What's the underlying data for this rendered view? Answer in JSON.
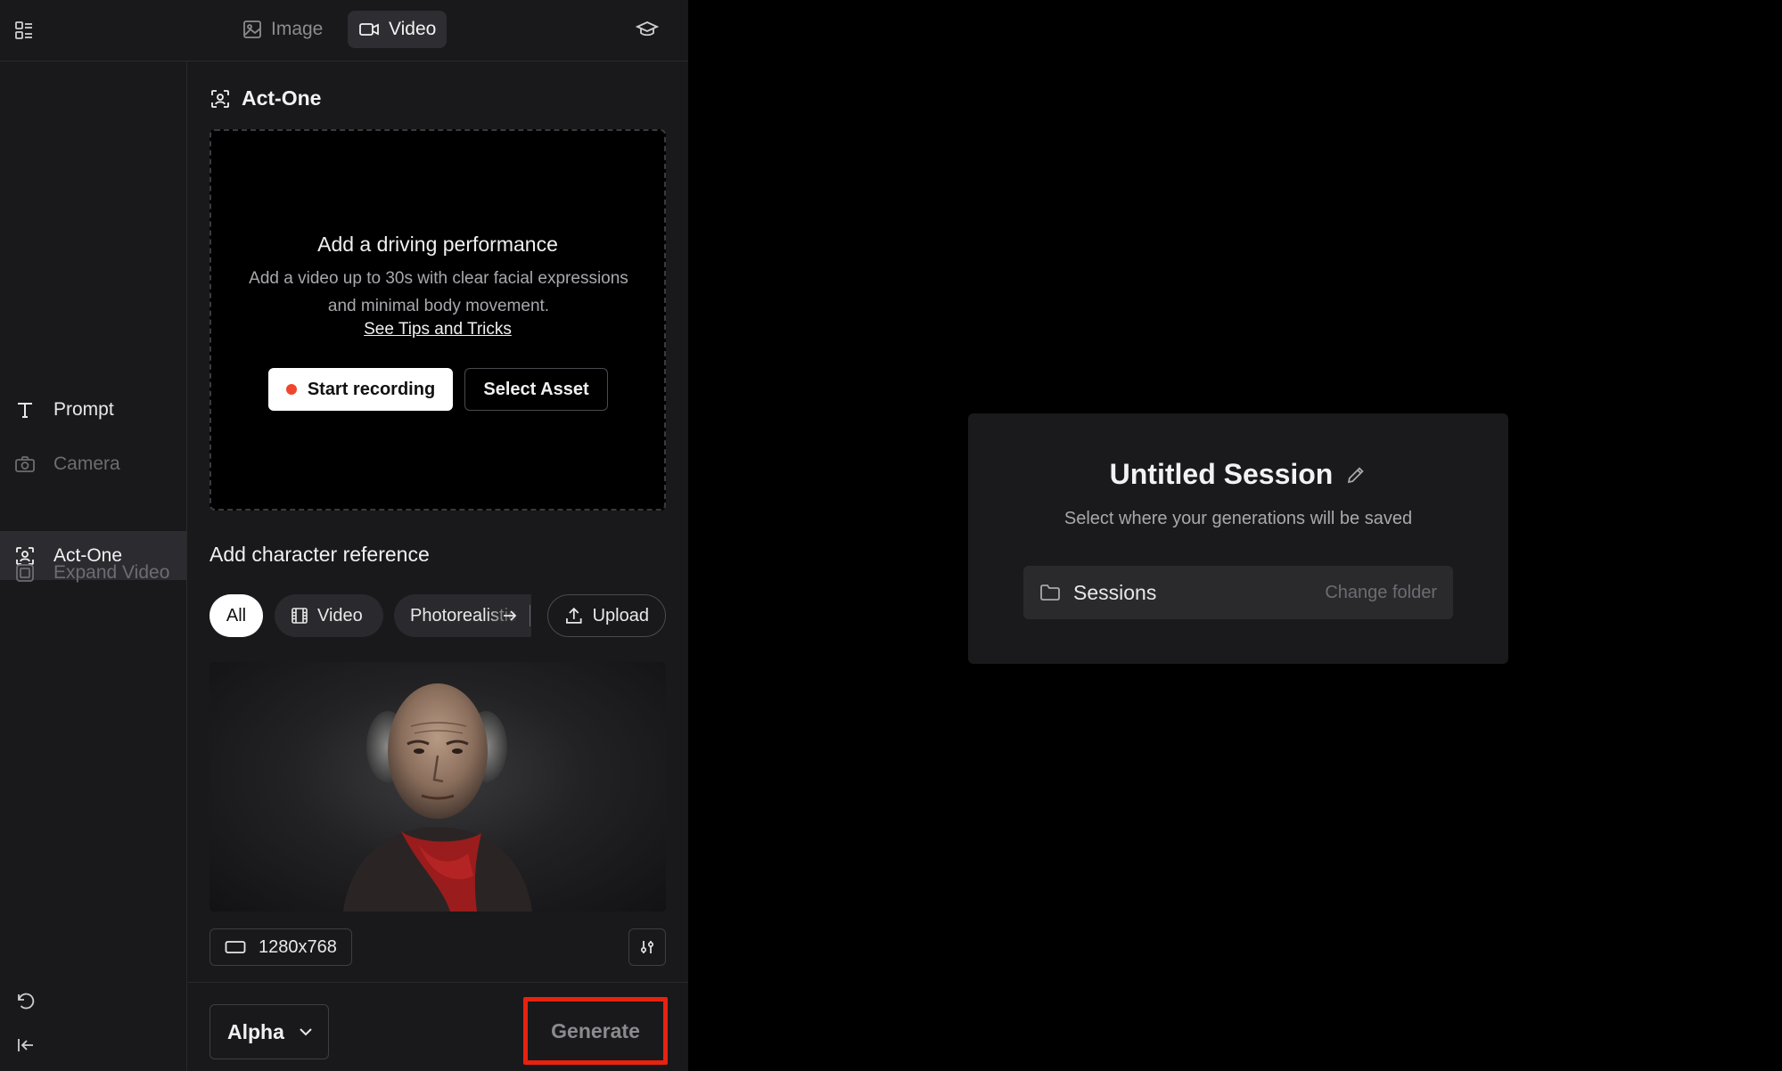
{
  "top_bar": {
    "tabs": [
      {
        "label": "Image",
        "icon": "image-icon",
        "active": false
      },
      {
        "label": "Video",
        "icon": "video-camera-icon",
        "active": true
      }
    ]
  },
  "sidebar": {
    "items": [
      {
        "label": "Prompt",
        "icon": "text-icon",
        "state": "normal"
      },
      {
        "label": "Camera",
        "icon": "camera-icon",
        "state": "disabled"
      },
      {
        "label": "Act-One",
        "icon": "face-scan-icon",
        "state": "active"
      },
      {
        "label": "Expand Video",
        "icon": "expand-icon",
        "state": "disabled"
      }
    ]
  },
  "tool": {
    "section_title": "Act-One",
    "drop_zone": {
      "heading": "Add a driving performance",
      "description": "Add a video up to 30s with clear facial expressions and minimal body movement.",
      "tips_link": "See Tips and Tricks",
      "start_recording": "Start recording",
      "select_asset": "Select Asset"
    },
    "character_reference": {
      "heading": "Add character reference",
      "filters": [
        "All",
        "Video",
        "Photorealistic"
      ],
      "active_filter": "All",
      "upload": "Upload"
    },
    "resolution": "1280x768",
    "model": "Alpha",
    "generate": "Generate"
  },
  "session": {
    "title": "Untitled Session",
    "subtitle": "Select where your generations will be saved",
    "folder": "Sessions",
    "change_folder": "Change folder"
  },
  "colors": {
    "panel_bg": "#19191b",
    "record_dot": "#f0462d",
    "highlight_box": "#e8220f"
  }
}
